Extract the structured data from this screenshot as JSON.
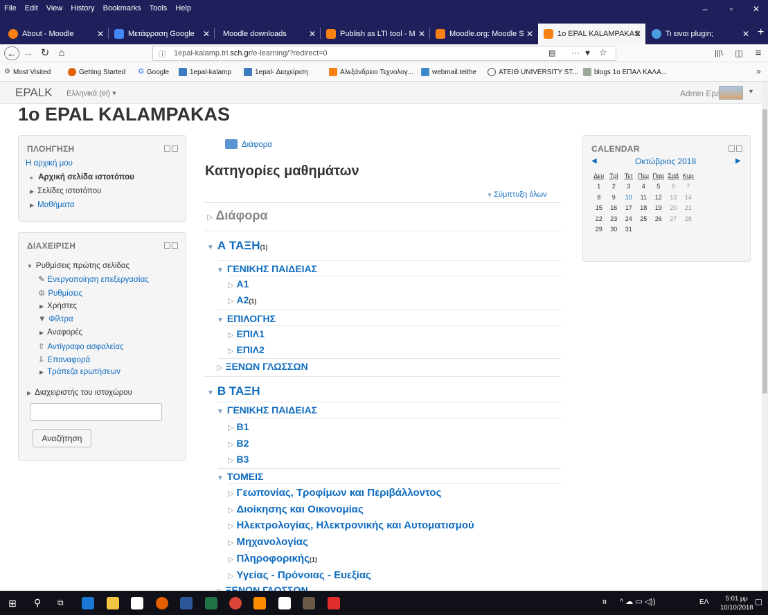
{
  "browser": {
    "menu": [
      "File",
      "Edit",
      "View",
      "History",
      "Bookmarks",
      "Tools",
      "Help"
    ],
    "tabs": [
      {
        "label": "About - Moodle",
        "color": "#f98012"
      },
      {
        "label": "Μετάφραση Google",
        "color": "#4285f4"
      },
      {
        "label": "Moodle downloads",
        "color": "#1f1f5c"
      },
      {
        "label": "Publish as LTI tool - M",
        "color": "#f98012"
      },
      {
        "label": "Moodle.org: Moodle S",
        "color": "#f98012"
      },
      {
        "label": "1o EPAL KALAMPAKAS",
        "color": "#f98012",
        "active": true
      },
      {
        "label": "Τι ειναι plugin;",
        "color": "#4a9be0"
      }
    ],
    "url_prefix": "1epal-kalamp.tri.",
    "url_domain": "sch.gr",
    "url_suffix": "/e-learning/?redirect=0",
    "bookmarks": [
      "Most Visited",
      "Getting Started",
      "Google",
      "1epal-kalamp",
      "1epal- Διαχείριση",
      "Αλεξάνδρειο Τεχνολογ...",
      "webmail.teithe",
      "ΑΤΕΙΘ UNIVERSITY ST...",
      "blogs 1ο ΕΠΑΛ ΚΑΛΑ..."
    ]
  },
  "site": {
    "brand": "EPALK",
    "language": "Ελληνικά (el) ▾",
    "user": "Admin Epal",
    "page_title": "1o EPAL KALAMPAKAS"
  },
  "navigation_block": {
    "title": "ΠΛΟΗΓΗΣΗ",
    "home": "Η αρχική μου",
    "site_home": "Αρχική σελίδα ιστοτόπου",
    "site_pages": "Σελίδες ιστοτόπου",
    "courses": "Μαθήματα"
  },
  "admin_block": {
    "title": "ΔΙΑΧΕΙΡΙΣΗ",
    "front_settings": "Ρυθμίσεις πρώτης σελίδας",
    "edit_on": "Ενεργοποίηση επεξεργασίας",
    "settings": "Ρυθμίσεις",
    "users": "Χρήστες",
    "filters": "Φίλτρα",
    "reports": "Αναφορές",
    "backup": "Αντίγραφο ασφαλείας",
    "restore": "Επαναφορά",
    "question_bank": "Τράπεζα ερωτήσεων",
    "site_admin": "Διαχειριστής του ιστοχώρου",
    "search_value": "",
    "search_button": "Αναζήτηση"
  },
  "main": {
    "breadcrumb": "Διάφορα",
    "heading": "Κατηγορίες μαθημάτων",
    "collapse_all": "Σύμπτυξη όλων",
    "cat_diafora": "Διάφορα",
    "cat_a": "Α ΤΑΞΗ",
    "cat_a_count": "(1)",
    "a_gen": "ΓΕΝΙΚΗΣ ΠΑΙΔΕΙΑΣ",
    "a1": "Α1",
    "a2": "Α2",
    "a2_count": "(1)",
    "a_epil": "ΕΠΙΛΟΓΗΣ",
    "epil1": "ΕΠΙΛ1",
    "epil2": "ΕΠΙΛ2",
    "a_xenon": "ΞΕΝΩΝ ΓΛΩΣΣΩΝ",
    "cat_b": "Β ΤΑΞΗ",
    "b_gen": "ΓΕΝΙΚΗΣ ΠΑΙΔΕΙΑΣ",
    "b1": "Β1",
    "b2": "Β2",
    "b3": "Β3",
    "b_tomeis": "ΤΟΜΕΙΣ",
    "t1": "Γεωπονίας, Τροφίμων και Περιβάλλοντος",
    "t2": "Διοίκησης και Οικονομίας",
    "t3": "Ηλεκτρολογίας, Ηλεκτρονικής και Αυτοματισμού",
    "t4": "Μηχανολογίας",
    "t5": "Πληροφορικής",
    "t5_count": "(1)",
    "t6": "Υγείας - Πρόνοιας - Ευεξίας",
    "b_xenon": "ΞΕΝΩΝ ΓΛΩΣΣΩΝ"
  },
  "calendar": {
    "title": "CALENDAR",
    "month": "Οκτώβριος 2018",
    "days": [
      "Δευ",
      "Τρί",
      "Τετ",
      "Πεμ",
      "Παρ",
      "Σαβ",
      "Κυρ"
    ],
    "weeks": [
      [
        "1",
        "2",
        "3",
        "4",
        "5",
        "6",
        "7"
      ],
      [
        "8",
        "9",
        "10",
        "11",
        "12",
        "13",
        "14"
      ],
      [
        "15",
        "16",
        "17",
        "18",
        "19",
        "20",
        "21"
      ],
      [
        "22",
        "23",
        "24",
        "25",
        "26",
        "27",
        "28"
      ],
      [
        "29",
        "30",
        "31",
        "",
        "",
        "",
        ""
      ]
    ],
    "today": "10"
  },
  "taskbar": {
    "lang": "ΕΛ",
    "time": "5:01 μμ",
    "date": "10/10/2018"
  }
}
